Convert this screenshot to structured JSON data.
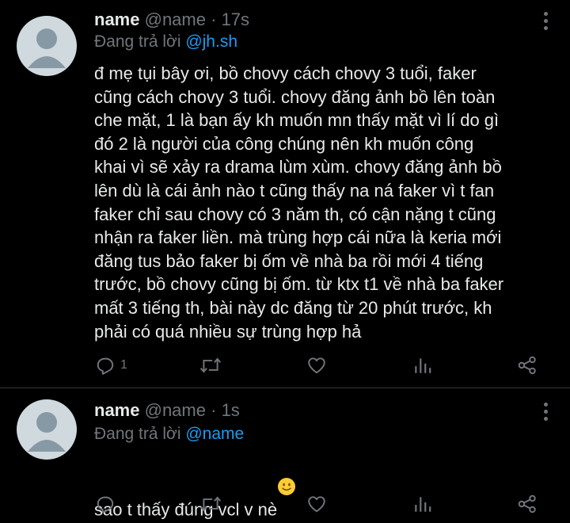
{
  "tweets": [
    {
      "name": "name",
      "handle": "@name",
      "separator": "·",
      "time": "17s",
      "reply_prefix": "Đang trả lời",
      "reply_to": "@jh.sh",
      "text": "đ mẹ tụi bây ơi, bồ chovy cách chovy 3 tuổi, faker\ncũng cách chovy 3 tuổi. chovy đăng ảnh bồ lên toàn\nche mặt, 1 là bạn ấy kh muốn mn thấy mặt vì lí do gì\nđó 2 là người của công chúng nên kh muốn công\nkhai vì sẽ xảy ra drama lùm xùm. chovy đăng ảnh bồ\nlên dù là cái ảnh nào t cũng thấy na ná faker vì t fan\nfaker chỉ sau chovy có 3 năm th, có cận nặng t cũng\nnhận ra faker liền. mà trùng hợp cái nữa là keria mới\nđăng tus bảo faker bị ốm về nhà ba rồi mới 4 tiếng\ntrước, bồ chovy cũng bị ốm. từ ktx t1 về nhà ba faker\nmất 3 tiếng th, bài này dc đăng từ 20 phút trước, kh\nphải có quá nhiều sự trùng hợp hả",
      "reply_count": "1",
      "icons": [
        "reply-icon",
        "retweet-icon",
        "like-icon",
        "views-icon",
        "share-icon"
      ]
    },
    {
      "name": "name",
      "handle": "@name",
      "separator": "·",
      "time": "1s",
      "reply_prefix": "Đang trả lời",
      "reply_to": "@name",
      "text": "sao t thấy đúng vcl v nè",
      "emoji": "slightly-smiling-face",
      "icons": [
        "reply-icon",
        "retweet-icon",
        "like-icon",
        "views-icon",
        "share-icon"
      ]
    }
  ],
  "colors": {
    "background": "#000000",
    "text": "#e7e9ea",
    "muted": "#71767b",
    "link": "#1d9bf0",
    "avatar": "#cfd9de",
    "divider": "#2f3336"
  }
}
